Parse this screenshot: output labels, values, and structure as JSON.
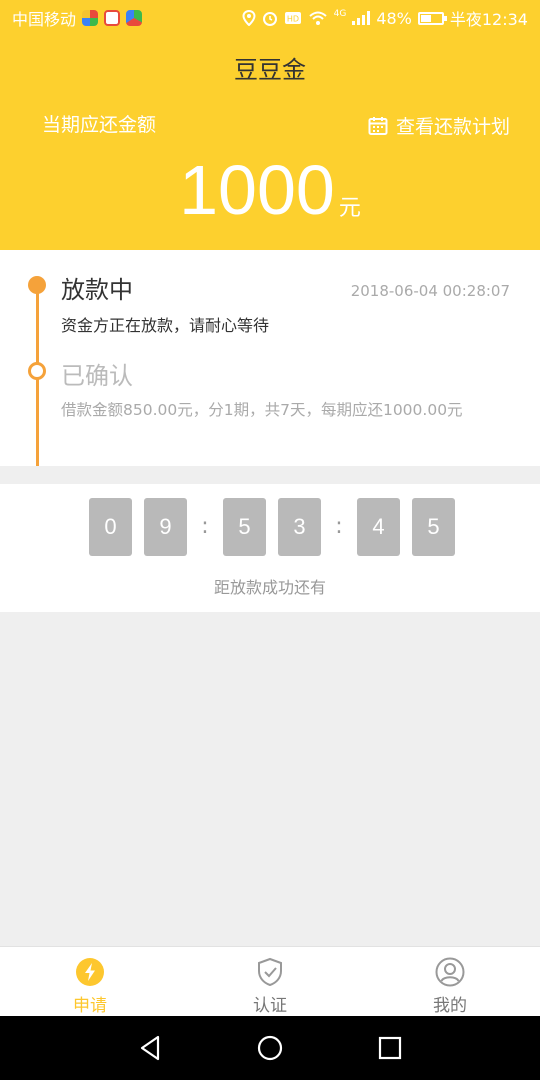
{
  "status_bar": {
    "carrier": "中国移动",
    "battery": "48%",
    "time": "半夜12:34",
    "network": "4G",
    "icons": [
      "location-icon",
      "alarm-icon",
      "hd-icon",
      "wifi-icon",
      "signal-icon",
      "battery-icon"
    ]
  },
  "header": {
    "title": "豆豆金",
    "period_label": "当期应还金额",
    "plan_link": "查看还款计划",
    "amount": "1000",
    "unit": "元",
    "accent_color": "#fdd02e"
  },
  "timeline": {
    "steps": [
      {
        "title": "放款中",
        "time": "2018-06-04 00:28:07",
        "desc": "资金方正在放款，请耐心等待",
        "state": "active"
      },
      {
        "title": "已确认",
        "desc": "借款金额850.00元，分1期，共7天，每期应还1000.00元",
        "state": "done"
      }
    ],
    "line_color": "#f5a23a"
  },
  "countdown": {
    "digits": [
      "0",
      "9",
      "5",
      "3",
      "4",
      "5"
    ],
    "separator": ":",
    "label": "距放款成功还有"
  },
  "tabbar": {
    "tabs": [
      {
        "label": "申请",
        "icon": "lightning-icon",
        "active": true
      },
      {
        "label": "认证",
        "icon": "shield-check-icon",
        "active": false
      },
      {
        "label": "我的",
        "icon": "user-icon",
        "active": false
      }
    ]
  },
  "navbar": {
    "buttons": [
      "back-icon",
      "home-icon",
      "recents-icon"
    ]
  }
}
